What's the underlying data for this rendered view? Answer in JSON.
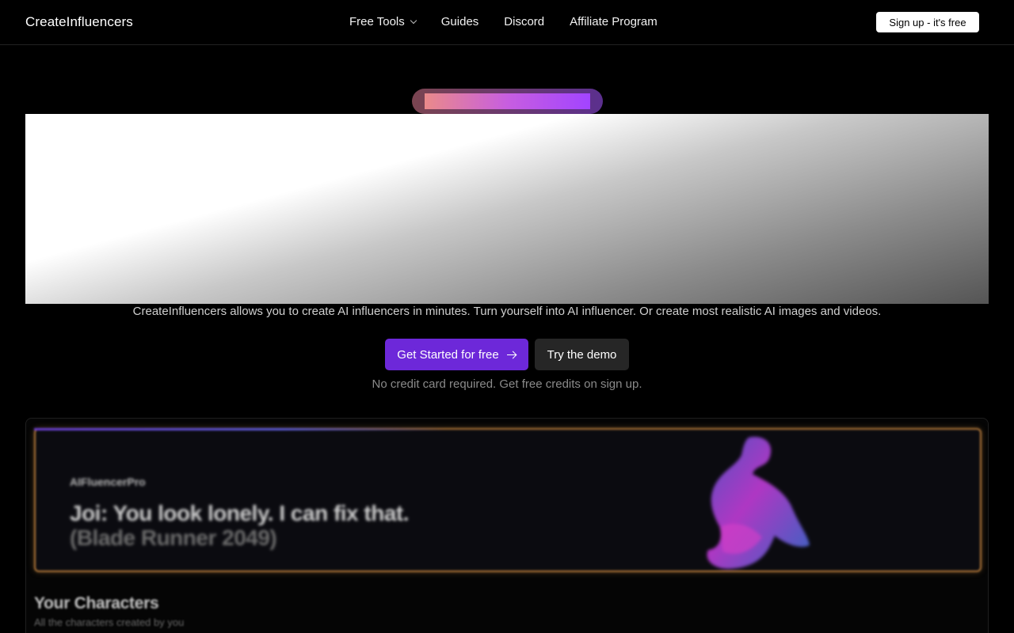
{
  "nav": {
    "brand": "CreateInfluencers",
    "links": [
      "Free Tools",
      "Guides",
      "Discord",
      "Affiliate Program"
    ],
    "signup_label": "Sign up - it's free"
  },
  "hero": {
    "subtitle": "CreateInfluencers allows you to create AI influencers in minutes. Turn yourself into AI influencer. Or create most realistic AI images and videos.",
    "cta_primary": "Get Started for free",
    "cta_demo": "Try the demo",
    "note": "No credit card required. Get free credits on sign up."
  },
  "preview": {
    "banner_brand": "AIFluencerPro",
    "banner_title": "Joi: You look lonely. I can fix that.",
    "banner_subtitle": "(Blade Runner 2049)",
    "section_title": "Your Characters",
    "section_subtitle": "All the characters created by you"
  },
  "colors": {
    "accent": "#6d28d9",
    "banner_border": "#b57a3a",
    "figure": "#c13cd8"
  }
}
